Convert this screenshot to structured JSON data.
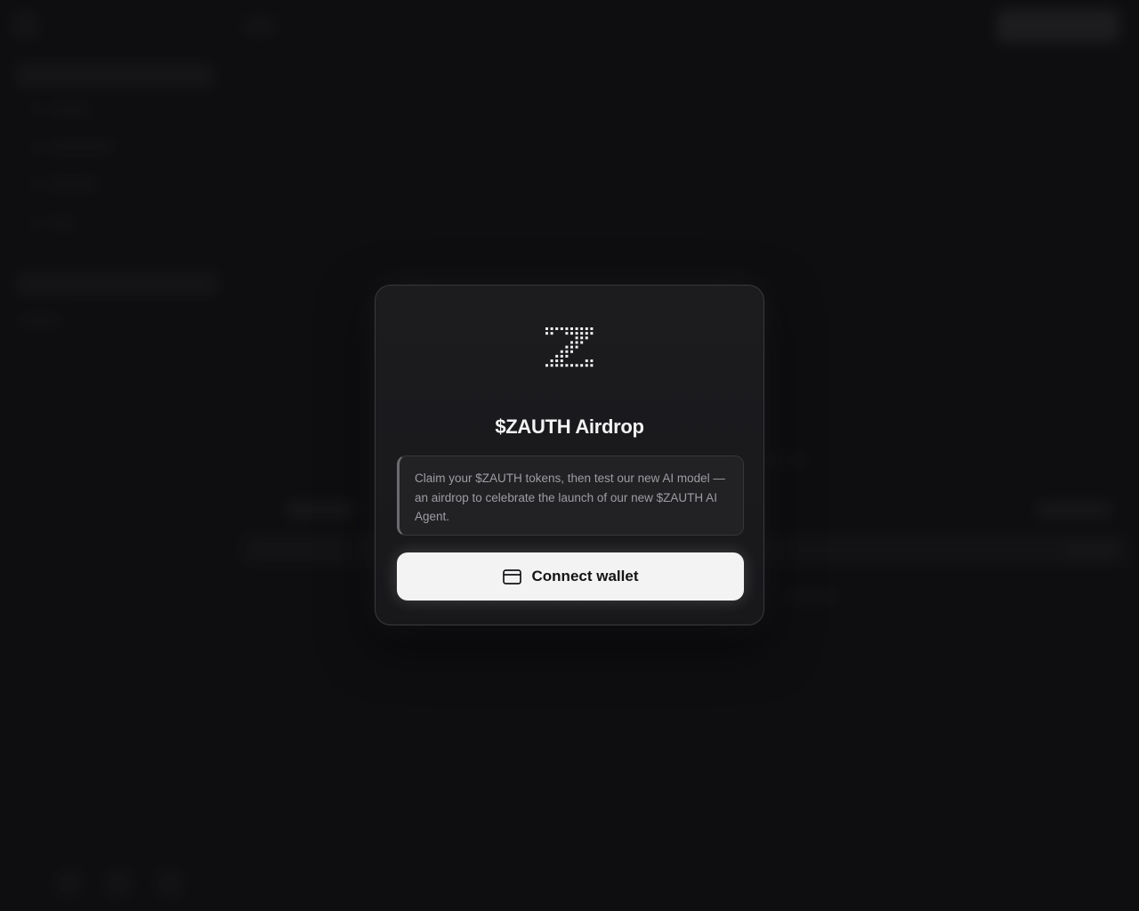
{
  "modal": {
    "title": "$ZAUTH Airdrop",
    "description": "Claim your $ZAUTH tokens, then test our new AI model — an airdrop to celebrate the launch of our new $ZAUTH AI Agent.",
    "connect_button_label": "Connect wallet",
    "connect_button_icon": "wallet-card-icon",
    "logo_icon": "z-dot-matrix-logo-icon"
  },
  "colors": {
    "background": "#121214",
    "modal_background": "#1c1c1f",
    "modal_border": "#3a3a3e",
    "title_text": "#f3f3f4",
    "description_text": "#9d9da3",
    "button_background": "#f3f3f4",
    "button_text": "#141416"
  }
}
